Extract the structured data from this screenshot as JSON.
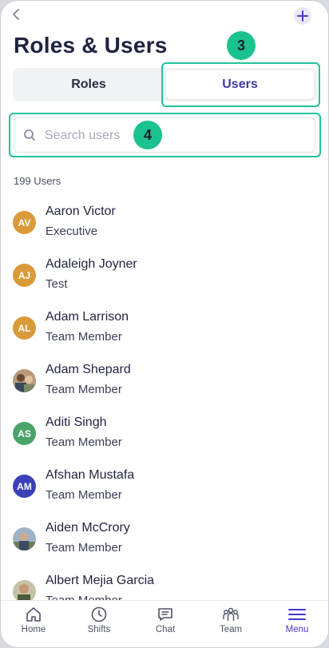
{
  "header": {
    "title": "Roles & Users",
    "back_icon": "chevron-left-icon",
    "add_icon": "plus-icon"
  },
  "annotations": {
    "badge_users": "3",
    "badge_search": "4"
  },
  "tabs": {
    "roles": "Roles",
    "users": "Users",
    "selected": "Users"
  },
  "search": {
    "placeholder": "Search users",
    "value": ""
  },
  "users_count": "199 Users",
  "users": [
    {
      "initials": "AV",
      "name": "Aaron Victor",
      "role": "Executive",
      "color": "#d99a3a"
    },
    {
      "initials": "AJ",
      "name": "Adaleigh Joyner",
      "role": "Test",
      "color": "#d99a3a"
    },
    {
      "initials": "AL",
      "name": "Adam Larrison",
      "role": "Team Member",
      "color": "#d99a3a"
    },
    {
      "initials": "",
      "name": "Adam Shepard",
      "role": "Team Member",
      "color": "#8a6a4f",
      "photo": true
    },
    {
      "initials": "AS",
      "name": "Aditi Singh",
      "role": "Team Member",
      "color": "#4aa36b"
    },
    {
      "initials": "AM",
      "name": "Afshan Mustafa",
      "role": "Team Member",
      "color": "#3b3fb8"
    },
    {
      "initials": "",
      "name": "Aiden McCrory",
      "role": "Team Member",
      "color": "#6c7f92",
      "photo": true
    },
    {
      "initials": "",
      "name": "Albert Mejia Garcia",
      "role": "Team Member",
      "color": "#8f8a6a",
      "photo": true
    }
  ],
  "nav": [
    {
      "label": "Home",
      "icon": "home-icon"
    },
    {
      "label": "Shifts",
      "icon": "clock-icon"
    },
    {
      "label": "Chat",
      "icon": "chat-icon"
    },
    {
      "label": "Team",
      "icon": "team-icon"
    },
    {
      "label": "Menu",
      "icon": "menu-icon",
      "active": true
    }
  ],
  "colors": {
    "accent": "#4338ca",
    "highlight": "#22c39a"
  }
}
